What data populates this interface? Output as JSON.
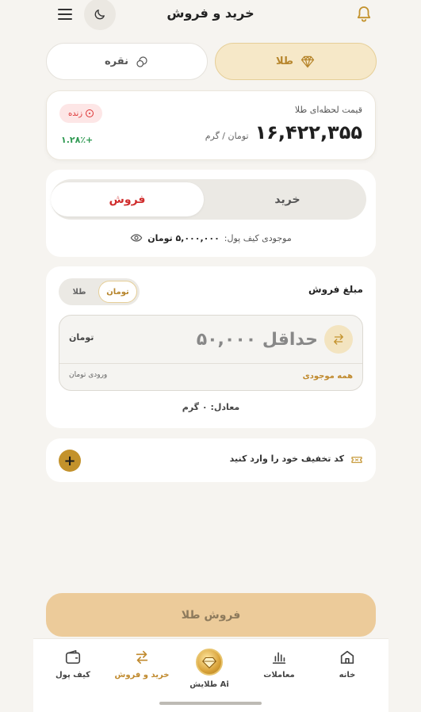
{
  "header": {
    "title": "خرید و فروش"
  },
  "metal_tabs": {
    "gold_label": "طلا",
    "silver_label": "نقره"
  },
  "price": {
    "label": "قیمت لحظه‌ای طلا",
    "value": "۱۶,۴۲۲,۳۵۵",
    "unit": "تومان / گرم",
    "live_label": "زنده",
    "change": "۱.۲۸٪+"
  },
  "trade": {
    "buy_label": "خرید",
    "sell_label": "فروش",
    "balance_label": "موجودی کیف پول:",
    "balance_value": "۵,۰۰۰,۰۰۰ تومان"
  },
  "amount": {
    "title": "مبلغ فروش",
    "unit_toman": "تومان",
    "unit_gold": "طلا",
    "placeholder": "حداقل ۵۰,۰۰۰",
    "input_unit": "تومان",
    "all_balance": "همه موجودی",
    "input_type_label": "ورودی تومان",
    "equivalent": "معادل: ۰ گرم"
  },
  "discount": {
    "text": "کد تخفیف خود را وارد کنید"
  },
  "submit": {
    "label": "فروش طلا"
  },
  "nav": {
    "home": "خانه",
    "trades": "معاملات",
    "ai": "طلایش Ai",
    "trade": "خرید و فروش",
    "wallet": "کیف پول"
  },
  "colors": {
    "accent": "#c08a2e",
    "sell": "#d02e2e",
    "positive": "#2f9a52",
    "background": "#f6f4f0"
  }
}
